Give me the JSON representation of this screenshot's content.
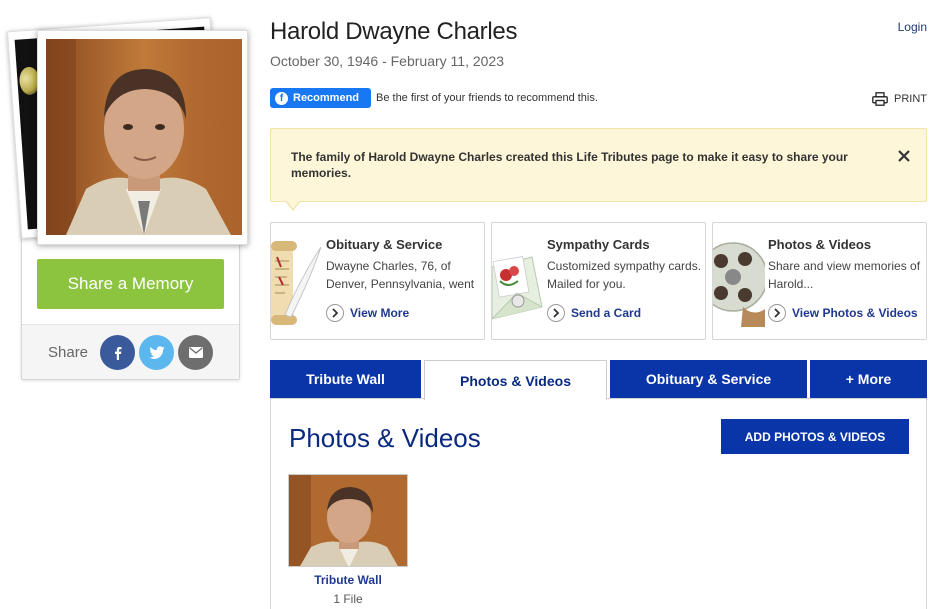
{
  "person": {
    "name": "Harold Dwayne Charles",
    "dates": "October 30, 1946 - February 11, 2023"
  },
  "header": {
    "login_label": "Login",
    "print_label": "PRINT",
    "fb_recommend_label": "Recommend",
    "fb_recommend_text": "Be the first of your friends to recommend this."
  },
  "left": {
    "share_memory_label": "Share a Memory",
    "share_label": "Share"
  },
  "notice": {
    "text": "The family of Harold Dwayne Charles created this Life Tributes page to make it easy to share your memories."
  },
  "cards": [
    {
      "title": "Obituary & Service",
      "desc": "Dwayne Charles, 76, of Denver, Pennsylvania, went",
      "link": "View More"
    },
    {
      "title": "Sympathy Cards",
      "desc": "Customized sympathy cards. Mailed for you.",
      "link": "Send a Card"
    },
    {
      "title": "Photos & Videos",
      "desc": "Share and view memories of Harold...",
      "link": "View Photos & Videos"
    }
  ],
  "tabs": [
    {
      "label": "Tribute Wall"
    },
    {
      "label": "Photos & Videos"
    },
    {
      "label": "Obituary & Service"
    },
    {
      "label": "+ More"
    }
  ],
  "panel": {
    "title": "Photos & Videos",
    "add_label": "ADD PHOTOS & VIDEOS",
    "album_name": "Tribute Wall",
    "album_count": "1 File"
  },
  "colors": {
    "primary_blue": "#0a35a8",
    "green": "#8cc43f",
    "facebook": "#3b5a9b",
    "twitter": "#5cb7ee",
    "email": "#6e6e6e",
    "notice_bg": "#fdf6d8"
  }
}
